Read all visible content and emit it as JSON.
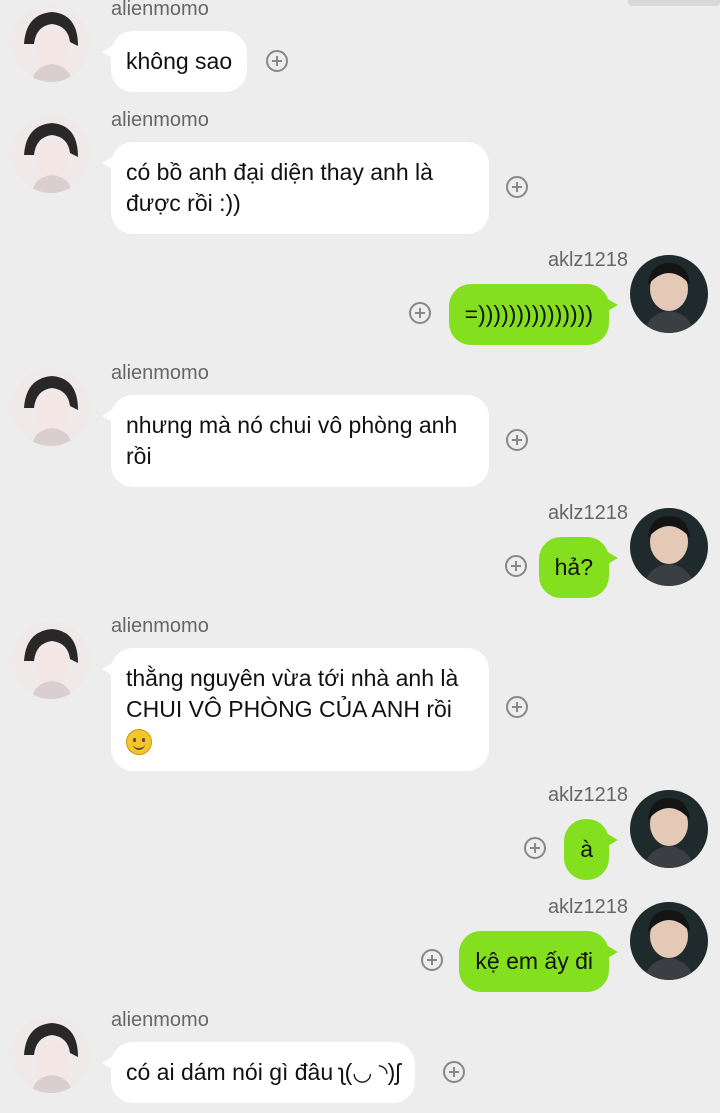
{
  "conversation": {
    "messages": [
      {
        "sender": "alienmomo",
        "side": "left",
        "lines": [
          "không sao"
        ]
      },
      {
        "sender": "alienmomo",
        "side": "left",
        "lines": [
          "có bồ anh đại diện thay anh là",
          "được rồi :))"
        ]
      },
      {
        "sender": "aklz1218",
        "side": "right",
        "lines": [
          "=)))))))))))))))"
        ]
      },
      {
        "sender": "alienmomo",
        "side": "left",
        "lines": [
          "nhưng mà nó chui vô phòng anh",
          "rồi"
        ]
      },
      {
        "sender": "aklz1218",
        "side": "right",
        "lines": [
          "hả?"
        ]
      },
      {
        "sender": "alienmomo",
        "side": "left",
        "lines": [
          "thằng nguyên vừa tới nhà anh là",
          "CHUI VÔ PHÒNG CỦA ANH rồi"
        ],
        "emoji": "smiling-face-emoji"
      },
      {
        "sender": "aklz1218",
        "side": "right",
        "lines": [
          "à"
        ]
      },
      {
        "sender": "aklz1218",
        "side": "right",
        "lines": [
          "kệ em ấy đi"
        ]
      },
      {
        "sender": "alienmomo",
        "side": "left",
        "lines": [
          "có ai dám nói gì đâu ʅ(◡ ◝)ʃ"
        ]
      }
    ]
  },
  "icons": {
    "react_button": "plus-circle-icon",
    "emoji": "smiling-face-emoji"
  },
  "colors": {
    "background": "#ededed",
    "incoming_bubble": "#ffffff",
    "outgoing_bubble": "#84e01f",
    "sender_name": "#666666"
  }
}
